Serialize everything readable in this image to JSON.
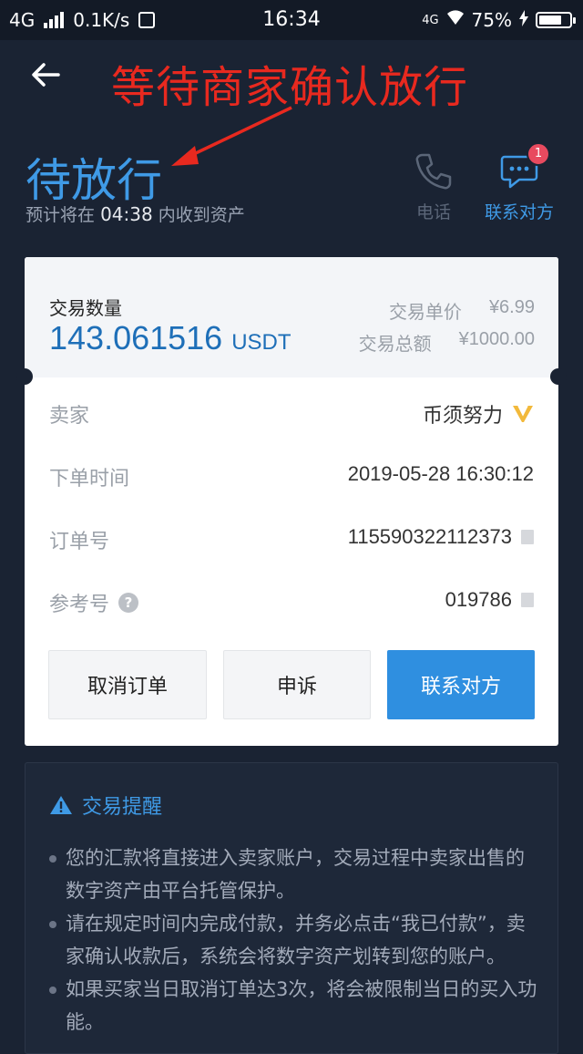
{
  "status_bar": {
    "network": "4G",
    "speed": "0.1K/s",
    "time": "16:34",
    "network_right": "4G",
    "battery": "75%",
    "battery_level": 0.75
  },
  "header": {
    "annotation": "等待商家确认放行",
    "status_title": "待放行",
    "eta_prefix": "预计将在",
    "eta_time": "04:38",
    "eta_suffix": "内收到资产",
    "phone_label": "电话",
    "contact_label": "联系对方",
    "contact_badge": "1"
  },
  "order": {
    "qty_label": "交易数量",
    "qty_value": "143.061516",
    "qty_unit": "USDT",
    "unit_price_label": "交易单价",
    "unit_price_value": "¥6.99",
    "total_label": "交易总额",
    "total_value": "¥1000.00",
    "rows": [
      {
        "label": "卖家",
        "value": "币须努力"
      },
      {
        "label": "下单时间",
        "value": "2019-05-28 16:30:12"
      },
      {
        "label": "订单号",
        "value": "115590322112373"
      },
      {
        "label": "参考号",
        "value": "019786"
      }
    ],
    "help_mark": "?",
    "buttons": {
      "cancel": "取消订单",
      "appeal": "申诉",
      "contact": "联系对方"
    }
  },
  "reminder": {
    "title": "交易提醒",
    "items": [
      "您的汇款将直接进入卖家账户，交易过程中卖家出售的数字资产由平台托管保护。",
      "请在规定时间内完成付款，并务必点击“我已付款”，卖家确认收款后，系统会将数字资产划转到您的账户。",
      "如果买家当日取消订单达3次，将会被限制当日的买入功能。"
    ]
  },
  "colors": {
    "accent": "#3f9ae6",
    "primary_button": "#2f8fe0",
    "annotation": "#e8291f",
    "background": "#1a2333"
  }
}
